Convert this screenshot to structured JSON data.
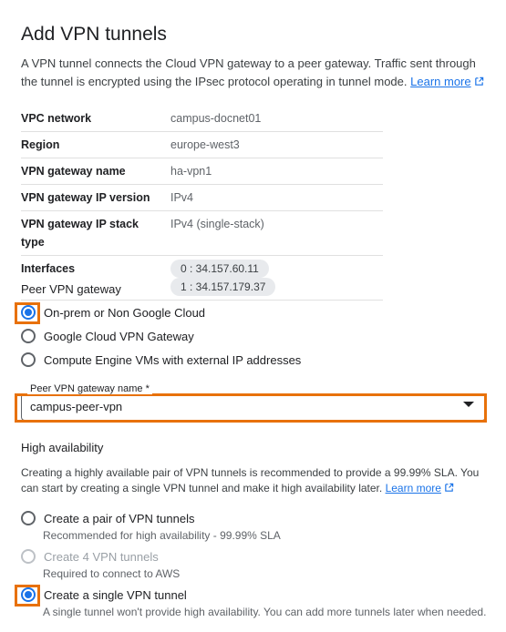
{
  "page": {
    "title": "Add VPN tunnels",
    "description": "A VPN tunnel connects the Cloud VPN gateway to a peer gateway. Traffic sent through the tunnel is encrypted using the IPsec protocol operating in tunnel mode.",
    "learn_more": "Learn more"
  },
  "info": {
    "vpc_network_label": "VPC network",
    "vpc_network_value": "campus-docnet01",
    "region_label": "Region",
    "region_value": "europe-west3",
    "gateway_name_label": "VPN gateway name",
    "gateway_name_value": "ha-vpn1",
    "ip_version_label": "VPN gateway IP version",
    "ip_version_value": "IPv4",
    "ip_stack_label": "VPN gateway IP stack type",
    "ip_stack_value": "IPv4 (single-stack)",
    "interfaces_label": "Interfaces",
    "interface_0": "0 : 34.157.60.11",
    "interface_1": "1 : 34.157.179.37"
  },
  "peer": {
    "section_title": "Peer VPN gateway",
    "options": [
      {
        "label": "On-prem or Non Google Cloud",
        "checked": true
      },
      {
        "label": "Google Cloud VPN Gateway",
        "checked": false
      },
      {
        "label": "Compute Engine VMs with external IP addresses",
        "checked": false
      }
    ],
    "select_label": "Peer VPN gateway name *",
    "select_value": "campus-peer-vpn"
  },
  "ha": {
    "section_title": "High availability",
    "description": "Creating a highly available pair of VPN tunnels is recommended to provide a 99.99% SLA. You can start by creating a single VPN tunnel and make it high availability later.",
    "learn_more": "Learn more",
    "options": [
      {
        "label": "Create a pair of VPN tunnels",
        "sub": "Recommended for high availability - 99.99% SLA",
        "checked": false,
        "disabled": false
      },
      {
        "label": "Create 4 VPN tunnels",
        "sub": "Required to connect to AWS",
        "checked": false,
        "disabled": true
      },
      {
        "label": "Create a single VPN tunnel",
        "sub": "A single tunnel won't provide high availability. You can add more tunnels later when needed.",
        "checked": true,
        "disabled": false
      }
    ]
  },
  "colors": {
    "accent": "#1a73e8",
    "highlight": "#e8710a"
  }
}
